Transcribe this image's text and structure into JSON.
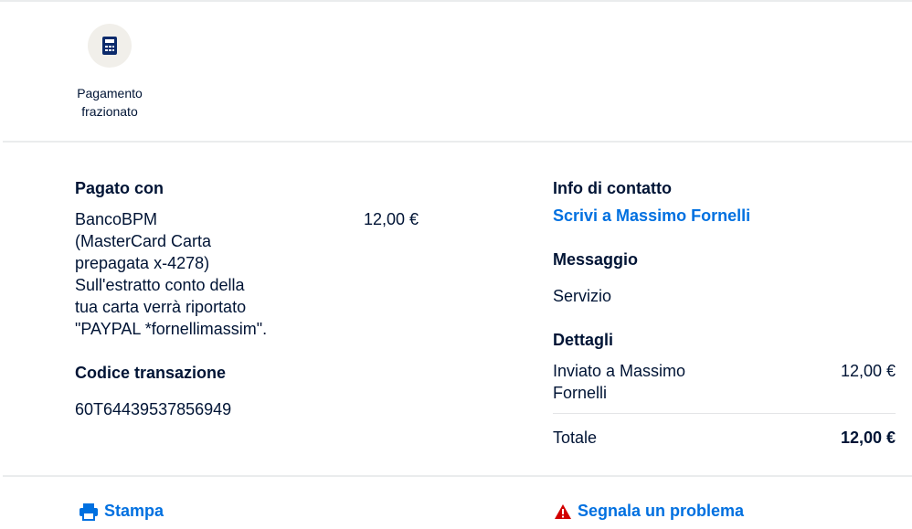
{
  "payment_option": {
    "label_line1": "Pagamento",
    "label_line2": "frazionato",
    "icon": "calculator-icon"
  },
  "paid_with": {
    "heading": "Pagato con",
    "source_lines": [
      "BancoBPM",
      "(MasterCard Carta",
      "prepagata x-4278)",
      "Sull'estratto conto della",
      "tua carta verrà riportato",
      "\"PAYPAL *fornellimassim\"."
    ],
    "amount": "12,00 €"
  },
  "transaction": {
    "heading": "Codice transazione",
    "code": "60T64439537856949"
  },
  "contact": {
    "heading": "Info di contatto",
    "link": "Scrivi a Massimo Fornelli"
  },
  "message": {
    "heading": "Messaggio",
    "text": "Servizio"
  },
  "details": {
    "heading": "Dettagli",
    "sent_line1": "Inviato a Massimo",
    "sent_line2": "Fornelli",
    "sent_amount": "12,00 €",
    "total_label": "Totale",
    "total_amount": "12,00 €"
  },
  "footer": {
    "print_label": "Stampa",
    "report_label": "Segnala un problema"
  },
  "colors": {
    "accent": "#0070e0",
    "text": "#001435",
    "warning": "#d20000"
  }
}
